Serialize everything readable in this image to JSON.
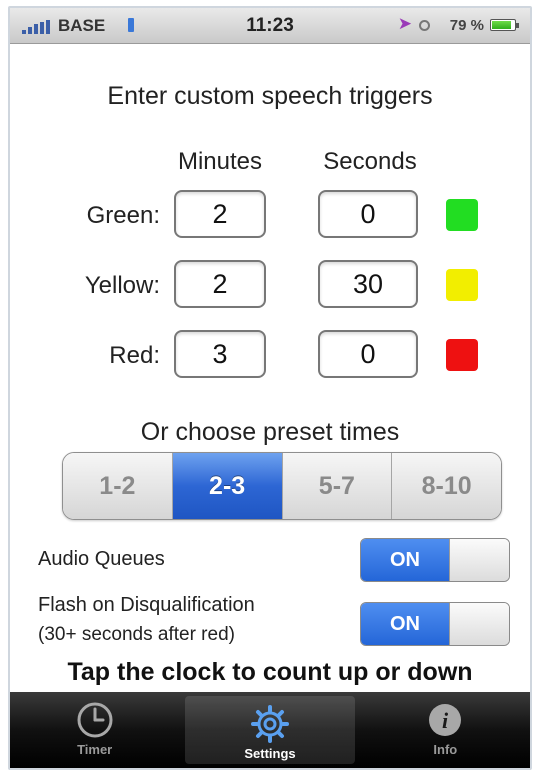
{
  "status_bar": {
    "carrier": "BASE",
    "time": "11:23",
    "battery": "79 %",
    "battery_level": 0.79
  },
  "heading": "Enter custom speech triggers",
  "columns": {
    "minutes": "Minutes",
    "seconds": "Seconds"
  },
  "rows": [
    {
      "label": "Green:",
      "minutes": "2",
      "seconds": "0",
      "color": "#22dd22"
    },
    {
      "label": "Yellow:",
      "minutes": "2",
      "seconds": "30",
      "color": "#f2ee00"
    },
    {
      "label": "Red:",
      "minutes": "3",
      "seconds": "0",
      "color": "#ee1111"
    }
  ],
  "preset": {
    "heading": "Or choose preset times",
    "options": [
      "1-2",
      "2-3",
      "5-7",
      "8-10"
    ],
    "selected": "2-3"
  },
  "settings": {
    "audio_label": "Audio Queues",
    "audio_state": "ON",
    "flash_label_line1": "Flash on Disqualification",
    "flash_label_line2": "(30+ seconds after red)",
    "flash_state": "ON"
  },
  "hint": "Tap the clock to count up or down",
  "tabs": [
    {
      "label": "Timer",
      "icon": "clock-icon"
    },
    {
      "label": "Settings",
      "icon": "gear-icon",
      "active": true
    },
    {
      "label": "Info",
      "icon": "info-icon"
    }
  ],
  "accent_color": "#2d66d4"
}
